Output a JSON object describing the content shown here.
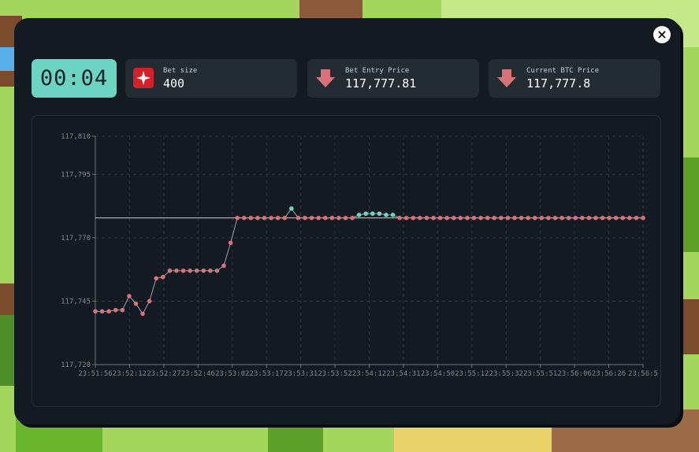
{
  "window": {
    "close_label": "×"
  },
  "timer": {
    "value": "00:04"
  },
  "cards": {
    "bet_size": {
      "label": "Bet size",
      "value": "400",
      "icon": "sparkle-icon"
    },
    "entry_price": {
      "label": "Bet Entry Price",
      "value": "117,777.81",
      "icon": "arrow-down-icon"
    },
    "current_price": {
      "label": "Current BTC Price",
      "value": "117,777.8",
      "icon": "arrow-down-icon"
    }
  },
  "colors": {
    "accent": "#6dd4c4",
    "down": "#d8727a",
    "up": "#6dd4c4",
    "panel": "#131a21",
    "card": "#232b33"
  },
  "chart_data": {
    "type": "line",
    "ylim": [
      117720,
      117810
    ],
    "y_ticks": [
      "117,720",
      "117,745",
      "117,770",
      "117,795",
      "117,810"
    ],
    "y_tick_values": [
      117720,
      117745,
      117770,
      117795,
      117810
    ],
    "x_ticks": [
      "23:51:56",
      "23:52:12",
      "23:52:27",
      "23:52:46",
      "23:53:02",
      "23:53:17",
      "23:53:31",
      "23:53:52",
      "23:54:12",
      "23:54:31",
      "23:54:50",
      "23:55:12",
      "23:55:32",
      "23:55:51",
      "23:56:06",
      "23:56:26",
      "23:56:5"
    ],
    "entry_price": 117777.81,
    "grid": true,
    "series": [
      {
        "values": [
          117741,
          117741,
          117741,
          117741.5,
          117741.5,
          117747,
          117744,
          117740,
          117745,
          117754,
          117754.5,
          117757,
          117757,
          117757,
          117757,
          117757,
          117757,
          117757,
          117757,
          117759,
          117768,
          117777.8,
          117777.8,
          117777.8,
          117777.8,
          117777.8,
          117777.8,
          117777.8,
          117777.8,
          117781.5,
          117777.8,
          117777.8,
          117777.8,
          117777.8,
          117777.8,
          117777.8,
          117777.8,
          117777.8,
          117777.8,
          117779,
          117779.5,
          117779.5,
          117779.5,
          117779,
          117779,
          117777.8,
          117777.8,
          117777.8,
          117777.8,
          117777.8,
          117777.8,
          117777.8,
          117777.8,
          117777.8,
          117777.8,
          117777.8,
          117777.8,
          117777.8,
          117777.8,
          117777.8,
          117777.8,
          117777.8,
          117777.8,
          117777.8,
          117777.8,
          117777.8,
          117777.8,
          117777.8,
          117777.8,
          117777.8,
          117777.8,
          117777.8,
          117777.8,
          117777.8,
          117777.8,
          117777.8,
          117777.8,
          117777.8,
          117777.8,
          117777.8,
          117777.8,
          117777.8
        ]
      }
    ]
  }
}
